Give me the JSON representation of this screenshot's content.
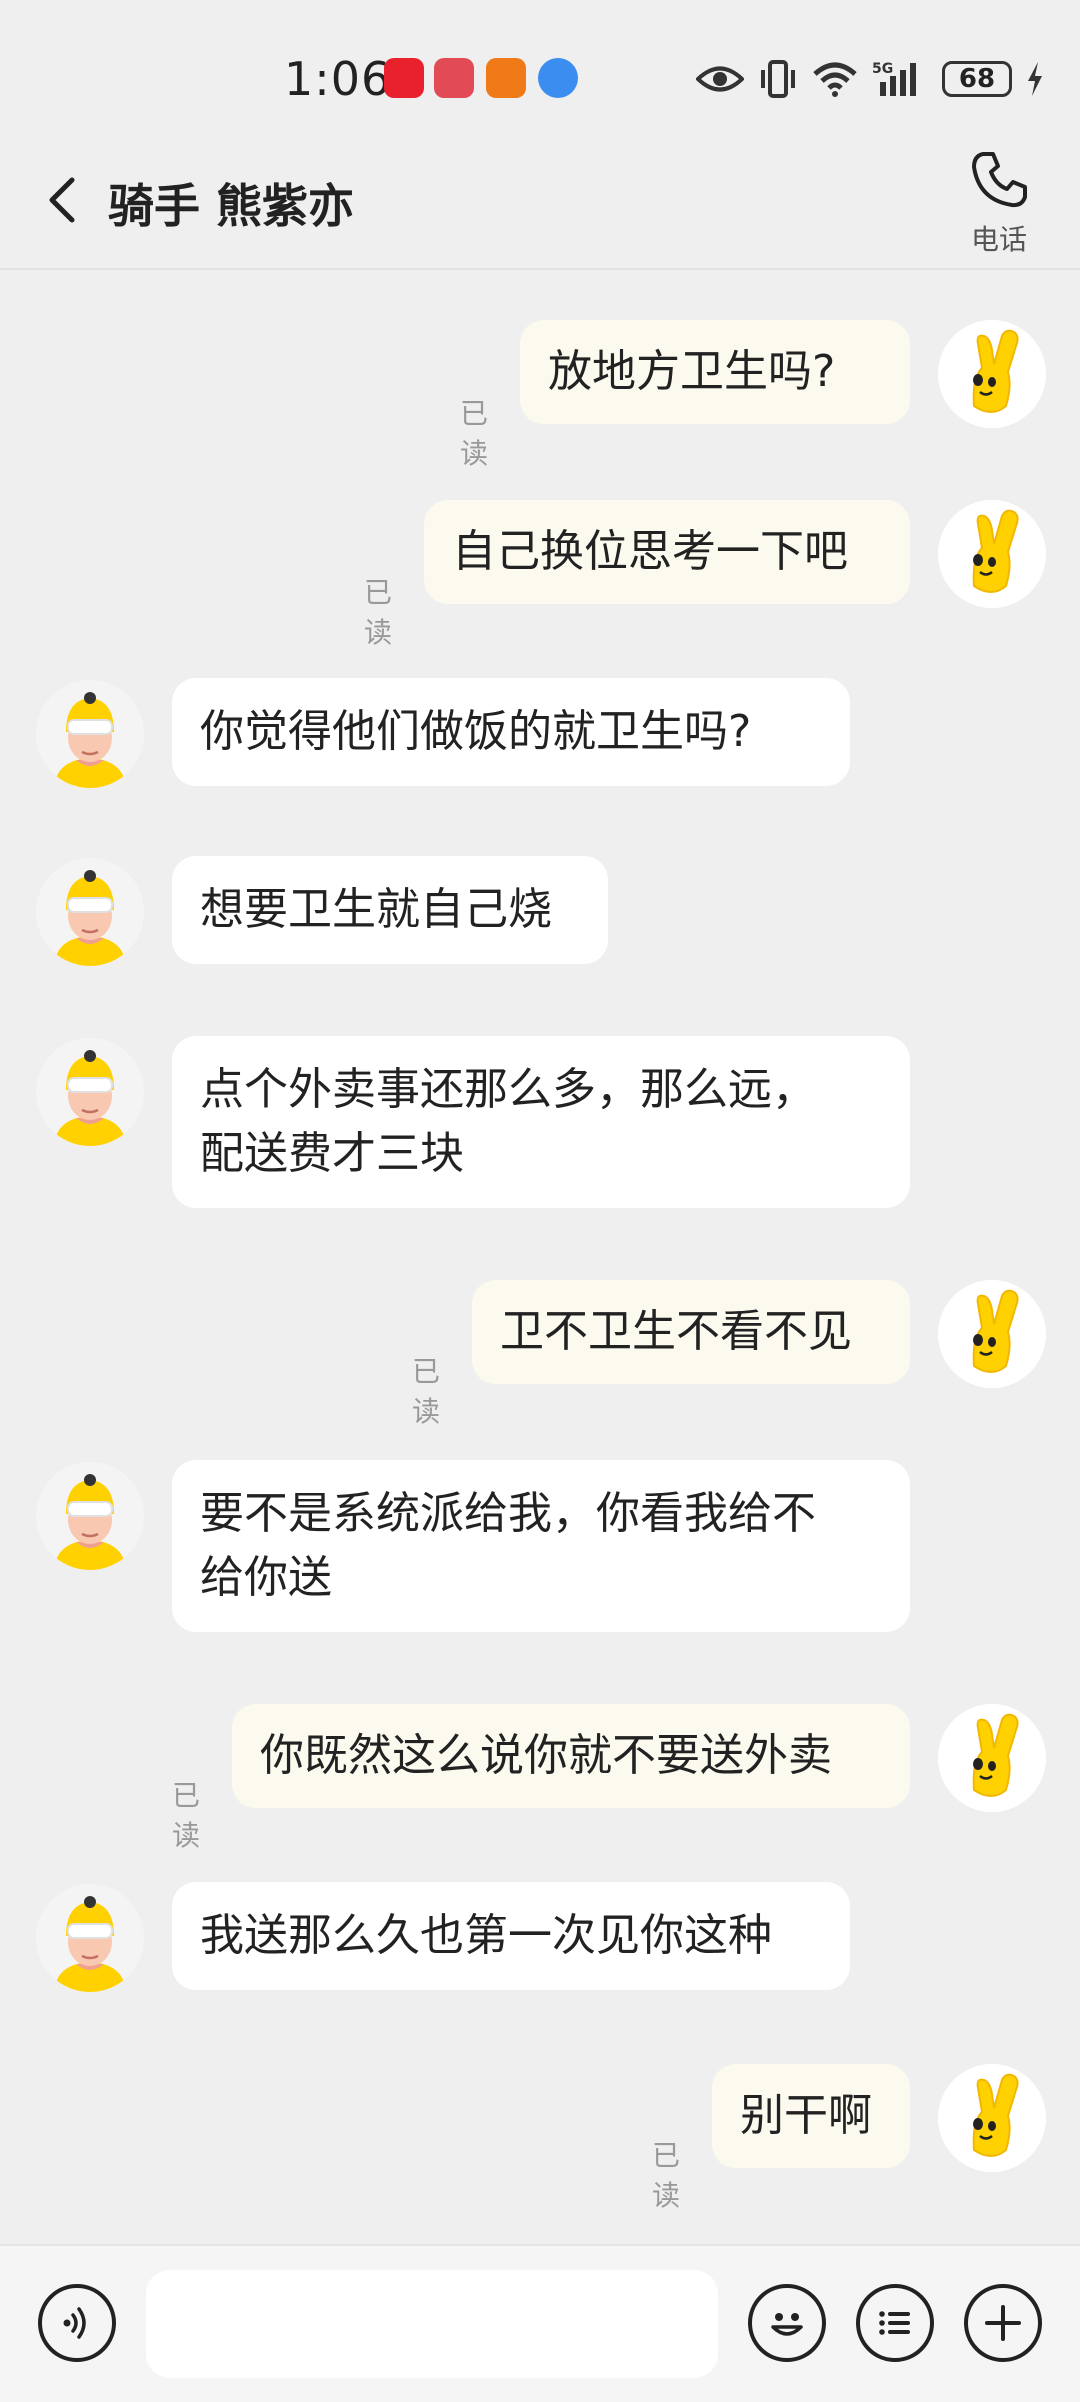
{
  "status_bar": {
    "time": "1:06",
    "battery": "68",
    "network": "5G"
  },
  "header": {
    "title": "骑手 熊紫亦",
    "call_label": "电话"
  },
  "messages": [
    {
      "sender": "me",
      "text": "放地方卫生吗?",
      "read": "已读"
    },
    {
      "sender": "me",
      "text": "自己换位思考一下吧",
      "read": "已读"
    },
    {
      "sender": "rider",
      "text": "你觉得他们做饭的就卫生吗?"
    },
    {
      "sender": "rider",
      "text": "想要卫生就自己烧"
    },
    {
      "sender": "rider",
      "line1": "点个外卖事还那么多，那么远，",
      "line2": "配送费才三块"
    },
    {
      "sender": "me",
      "text": "卫不卫生不看不见",
      "read": "已读"
    },
    {
      "sender": "rider",
      "line1": "要不是系统派给我，你看我给不",
      "line2": "给你送"
    },
    {
      "sender": "me",
      "text": "你既然这么说你就不要送外卖",
      "read": "已读"
    },
    {
      "sender": "rider",
      "text": "我送那么久也第一次见你这种"
    },
    {
      "sender": "me",
      "text": "别干啊",
      "read": "已读"
    }
  ],
  "input": {
    "placeholder": ""
  },
  "colors": {
    "my_bubble": "#fcfaef",
    "rider_bubble": "#ffffff",
    "background": "#efefef",
    "accent_yellow": "#ffd100"
  },
  "icons": [
    "back-icon",
    "phone-icon",
    "voice-icon",
    "emoji-icon",
    "quick-reply-icon",
    "plus-icon",
    "eye-icon",
    "vibrate-icon",
    "wifi-icon",
    "signal-icon",
    "charging-icon"
  ]
}
